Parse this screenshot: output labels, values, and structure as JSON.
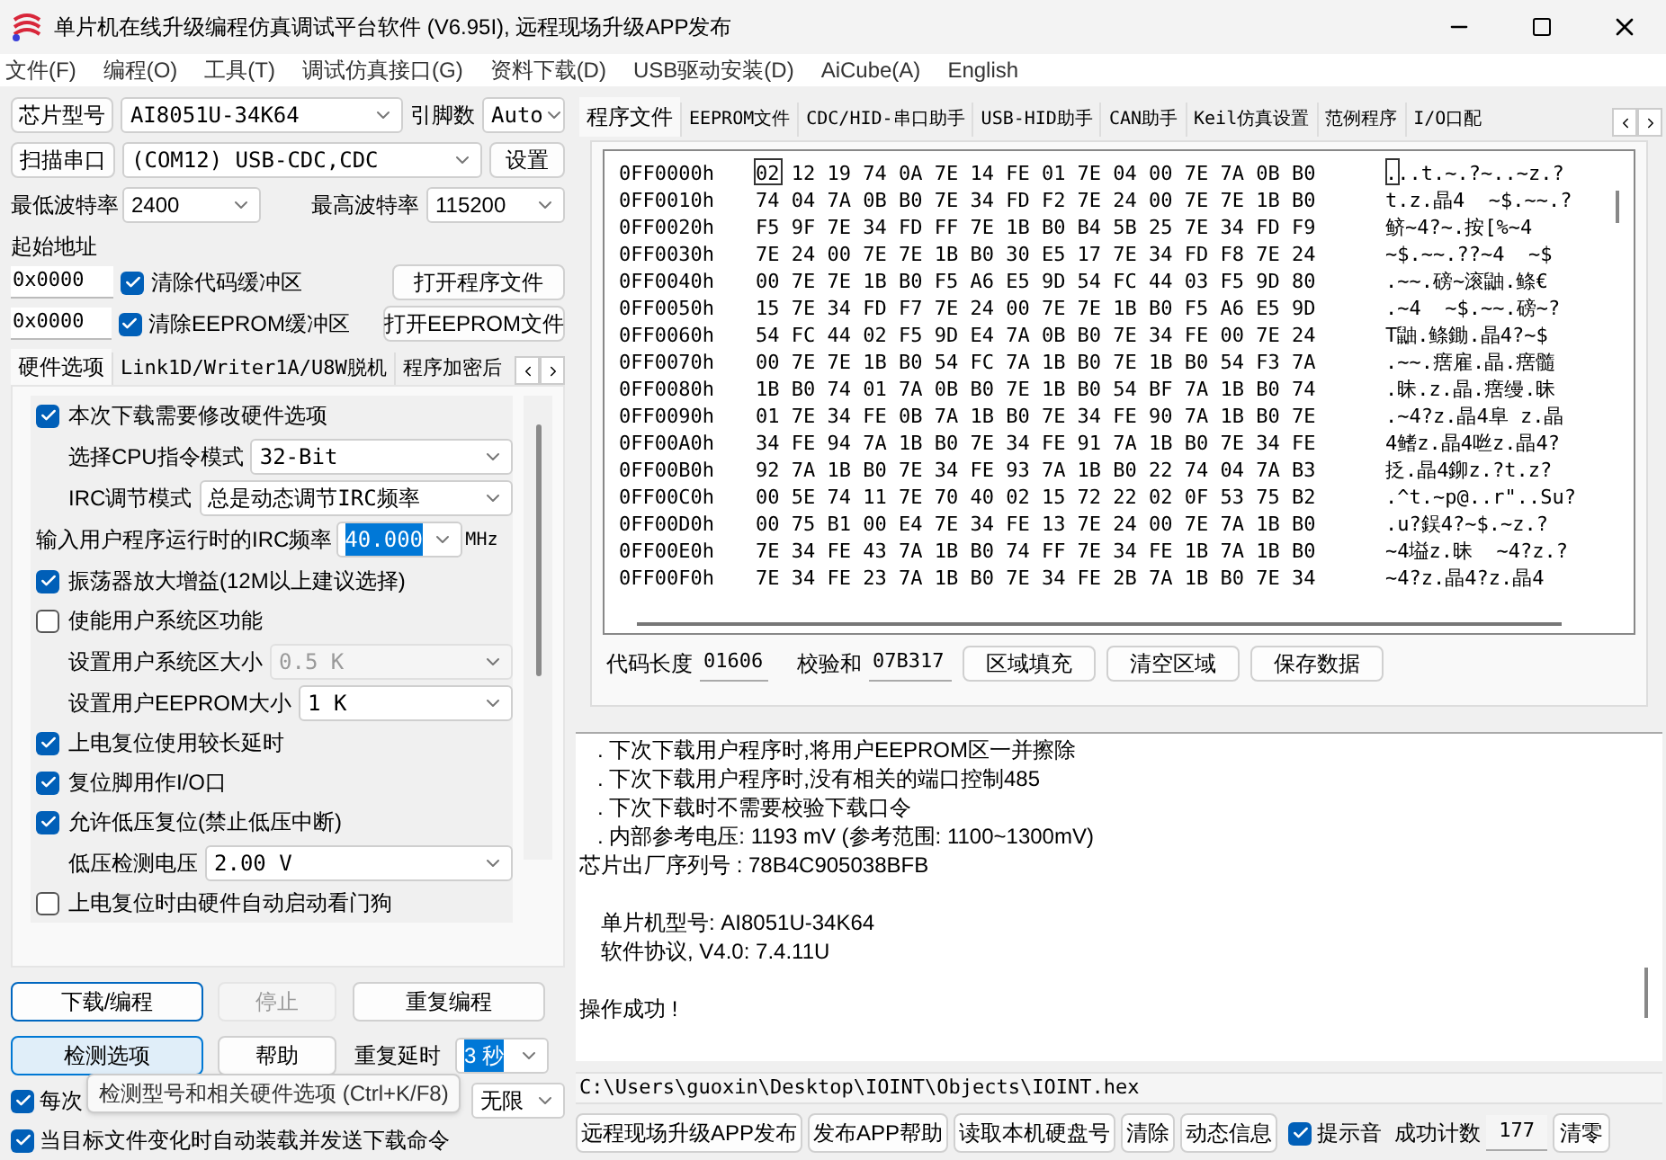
{
  "window": {
    "title": "单片机在线升级编程仿真调试平台软件 (V6.95I), 远程现场升级APP发布"
  },
  "menu": [
    "文件(F)",
    "编程(O)",
    "工具(T)",
    "调试仿真接口(G)",
    "资料下载(D)",
    "USB驱动安装(D)",
    "AiCube(A)",
    "English"
  ],
  "chip": {
    "button": "芯片型号",
    "value": "AI8051U-34K64",
    "pins_label": "引脚数",
    "pins_value": "Auto"
  },
  "port": {
    "button": "扫描串口",
    "value": "(COM12) USB-CDC,CDC",
    "settings": "设置"
  },
  "baud": {
    "min_label": "最低波特率",
    "min_value": "2400",
    "max_label": "最高波特率",
    "max_value": "115200"
  },
  "start_address": {
    "label": "起始地址",
    "rows": [
      {
        "address": "0x0000",
        "checkbox": "清除代码缓冲区",
        "checked": true,
        "button": "打开程序文件"
      },
      {
        "address": "0x0000",
        "checkbox": "清除EEPROM缓冲区",
        "checked": true,
        "button": "打开EEPROM文件"
      }
    ]
  },
  "left_tabs": [
    {
      "label": "硬件选项",
      "selected": true
    },
    {
      "label": "Link1D/Writer1A/U8W脱机",
      "selected": false
    },
    {
      "label": "程序加密后",
      "selected": false
    }
  ],
  "hardware_options": [
    {
      "kind": "checkbox",
      "label": "本次下载需要修改硬件选项",
      "checked": true
    },
    {
      "kind": "select",
      "label": "选择CPU指令模式",
      "value": "32-Bit",
      "disabled": false
    },
    {
      "kind": "select",
      "label": "IRC调节模式",
      "value": "总是动态调节IRC频率",
      "disabled": false
    },
    {
      "kind": "combo",
      "label": "输入用户程序运行时的IRC频率",
      "value": "40.000",
      "unit": "MHz"
    },
    {
      "kind": "checkbox",
      "label": "振荡器放大增益(12M以上建议选择)",
      "checked": true
    },
    {
      "kind": "checkbox",
      "label": "使能用户系统区功能",
      "checked": false
    },
    {
      "kind": "select",
      "label": "设置用户系统区大小",
      "value": "0.5 K",
      "disabled": true
    },
    {
      "kind": "select",
      "label": "设置用户EEPROM大小",
      "value": "1   K",
      "disabled": false
    },
    {
      "kind": "checkbox",
      "label": "上电复位使用较长延时",
      "checked": true
    },
    {
      "kind": "checkbox",
      "label": "复位脚用作I/O口",
      "checked": true
    },
    {
      "kind": "checkbox",
      "label": "允许低压复位(禁止低压中断)",
      "checked": true
    },
    {
      "kind": "select",
      "label": "低压检测电压",
      "value": "2.00 V",
      "disabled": false
    },
    {
      "kind": "checkbox",
      "label": "上电复位时由硬件自动启动看门狗",
      "checked": false
    }
  ],
  "action_buttons": [
    {
      "label": "下载/编程",
      "default": true,
      "disabled": false,
      "hovered": false
    },
    {
      "label": "停止",
      "default": false,
      "disabled": true,
      "hovered": false
    },
    {
      "label": "重复编程",
      "default": false,
      "disabled": false,
      "hovered": false
    }
  ],
  "detect_row": {
    "buttons": [
      {
        "label": "检测选项",
        "hovered": true
      },
      {
        "label": "帮助",
        "hovered": false
      }
    ],
    "delay_label": "重复延时",
    "delay_value": "3 秒"
  },
  "reload_option": {
    "label": "每次",
    "checked": true,
    "repeat_value": "无限"
  },
  "auto_option": {
    "label": "当目标文件变化时自动装载并发送下载命令",
    "checked": true
  },
  "tooltip": "检测型号和相关硬件选项 (Ctrl+K/F8)",
  "right_tabs": [
    {
      "label": "程序文件",
      "selected": true
    },
    {
      "label": "EEPROM文件",
      "selected": false
    },
    {
      "label": "CDC/HID-串口助手",
      "selected": false
    },
    {
      "label": "USB-HID助手",
      "selected": false
    },
    {
      "label": "CAN助手",
      "selected": false
    },
    {
      "label": "Keil仿真设置",
      "selected": false
    },
    {
      "label": "范例程序",
      "selected": false
    },
    {
      "label": "I/O口配",
      "selected": false
    }
  ],
  "hex_rows": [
    {
      "address": "0FF0000h",
      "bytes": "02 12 19 74 0A 7E 14 FE 01 7E 04 00 7E 7A 0B B0",
      "ascii": "...t.~.?~..~z.?",
      "cursor": true
    },
    {
      "address": "0FF0010h",
      "bytes": "74 04 7A 0B B0 7E 34 FD F2 7E 24 00 7E 7E 1B B0",
      "ascii": "t.z.晶4  ~$.~~.?",
      "cursor": false
    },
    {
      "address": "0FF0020h",
      "bytes": "F5 9F 7E 34 FD FF 7E 1B B0 B4 5B 25 7E 34 FD F9",
      "ascii": "鲚~4?~.按[%~4",
      "cursor": false
    },
    {
      "address": "0FF0030h",
      "bytes": "7E 24 00 7E 7E 1B B0 30 E5 17 7E 34 FD F8 7E 24",
      "ascii": "~$.~~.??~4  ~$",
      "cursor": false
    },
    {
      "address": "0FF0040h",
      "bytes": "00 7E 7E 1B B0 F5 A6 E5 9D 54 FC 44 03 F5 9D 80",
      "ascii": ".~~.磅~滚鼬.鲦€",
      "cursor": false
    },
    {
      "address": "0FF0050h",
      "bytes": "15 7E 34 FD F7 7E 24 00 7E 7E 1B B0 F5 A6 E5 9D",
      "ascii": ".~4  ~$.~~.磅~?",
      "cursor": false
    },
    {
      "address": "0FF0060h",
      "bytes": "54 FC 44 02 F5 9D E4 7A 0B B0 7E 34 FE 00 7E 24",
      "ascii": "T鼬.鲦鋤.晶4?~$",
      "cursor": false
    },
    {
      "address": "0FF0070h",
      "bytes": "00 7E 7E 1B B0 54 FC 7A 1B B0 7E 1B B0 54 F3 7A",
      "ascii": ".~~.瘔雇.晶.瘔髓",
      "cursor": false
    },
    {
      "address": "0FF0080h",
      "bytes": "1B B0 74 01 7A 0B B0 7E 1B B0 54 BF 7A 1B B0 74",
      "ascii": ".昧.z.晶.瘔缦.昧",
      "cursor": false
    },
    {
      "address": "0FF0090h",
      "bytes": "01 7E 34 FE 0B 7A 1B B0 7E 34 FE 90 7A 1B B0 7E",
      "ascii": ".~4?z.晶4阜 z.晶",
      "cursor": false
    },
    {
      "address": "0FF00A0h",
      "bytes": "34 FE 94 7A 1B B0 7E 34 FE 91 7A 1B B0 7E 34 FE",
      "ascii": "4鳍z.晶4咝z.晶4?",
      "cursor": false
    },
    {
      "address": "0FF00B0h",
      "bytes": "92 7A 1B B0 7E 34 FE 93 7A 1B B0 22 74 04 7A B3",
      "ascii": "抸.晶4鉚z.?t.z?",
      "cursor": false
    },
    {
      "address": "0FF00C0h",
      "bytes": "00 5E 74 11 7E 70 40 02 15 72 22 02 0F 53 75 B2",
      "ascii": ".^t.~p@..r\"..Su?",
      "cursor": false
    },
    {
      "address": "0FF00D0h",
      "bytes": "00 75 B1 00 E4 7E 34 FE 13 7E 24 00 7E 7A 1B B0",
      "ascii": ".u?鋘4?~$.~z.?",
      "cursor": false
    },
    {
      "address": "0FF00E0h",
      "bytes": "7E 34 FE 43 7A 1B B0 74 FF 7E 34 FE 1B 7A 1B B0",
      "ascii": "~4塧z.昧  ~4?z.?",
      "cursor": false
    },
    {
      "address": "0FF00F0h",
      "bytes": "7E 34 FE 23 7A 1B B0 7E 34 FE 2B 7A 1B B0 7E 34",
      "ascii": "~4?z.晶4?z.晶4",
      "cursor": false
    }
  ],
  "hex_footer": {
    "length_label": "代码长度",
    "length_value": "01606",
    "checksum_label": "校验和",
    "checksum_value": "07B317",
    "buttons": [
      "区域填充",
      "清空区域",
      "保存数据"
    ]
  },
  "log": [
    {
      "kind": "bullet",
      "text": ". 下次下载用户程序时,将用户EEPROM区一并擦除",
      "space_before": false
    },
    {
      "kind": "bullet",
      "text": ". 下次下载用户程序时,没有相关的端口控制485",
      "space_before": false
    },
    {
      "kind": "bullet",
      "text": ". 下次下载时不需要校验下载口令",
      "space_before": false
    },
    {
      "kind": "bullet",
      "text": ". 内部参考电压: 1193 mV (参考范围: 1100~1300mV)",
      "space_before": false
    },
    {
      "kind": "plain",
      "text": "芯片出厂序列号 : 78B4C905038BFB",
      "space_before": false
    },
    {
      "kind": "indented",
      "text": "单片机型号: AI8051U-34K64",
      "space_before": true
    },
    {
      "kind": "indented",
      "text": "软件协议, V4.0: 7.4.11U",
      "space_before": false
    },
    {
      "kind": "plain",
      "text": "操作成功 !",
      "space_before": true
    }
  ],
  "file_path": "C:\\Users\\guoxin\\Desktop\\IOINT\\Objects\\IOINT.hex",
  "bottom_bar": {
    "buttons": [
      "远程现场升级APP发布",
      "发布APP帮助",
      "读取本机硬盘号",
      "清除",
      "动态信息"
    ],
    "sound": {
      "label": "提示音",
      "checked": true
    },
    "count_label": "成功计数",
    "count_value": "177",
    "reset": "清零"
  }
}
